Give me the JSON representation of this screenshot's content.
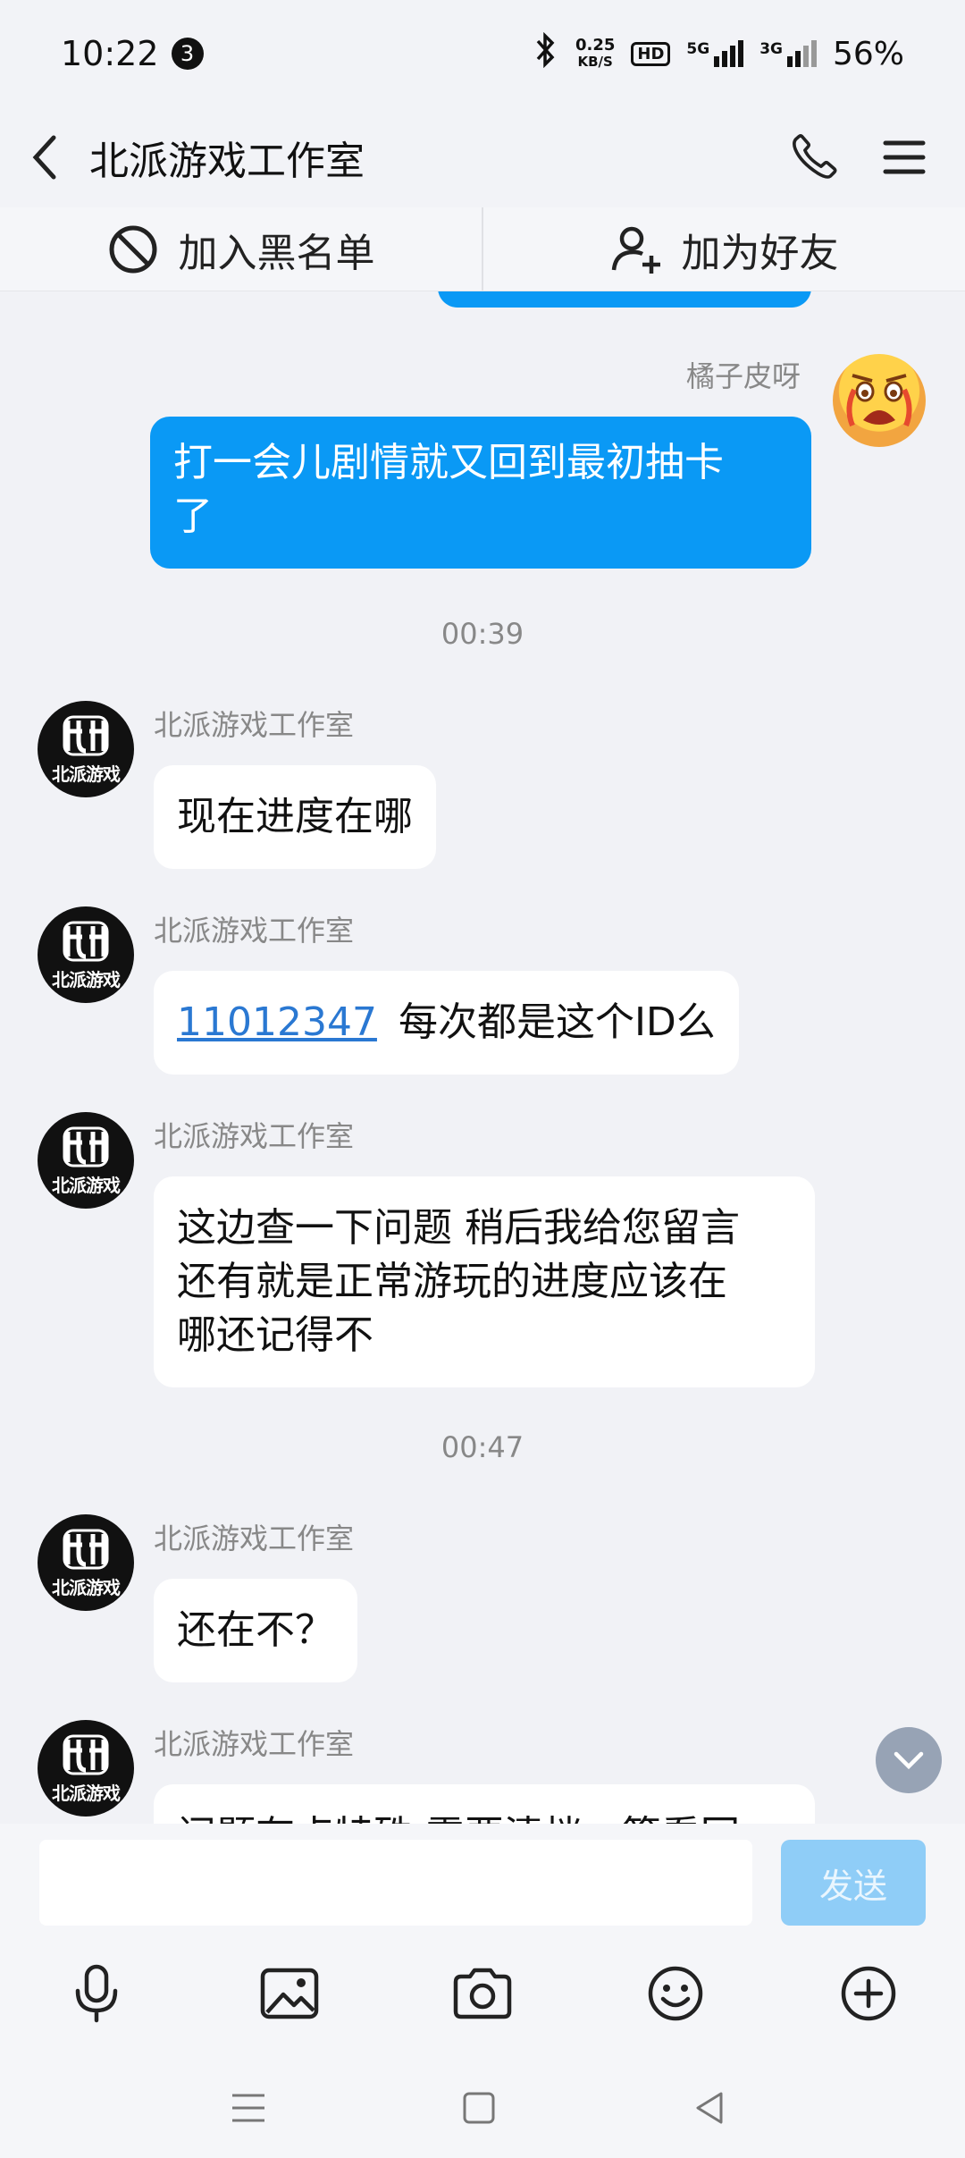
{
  "status_bar": {
    "time": "10:22",
    "notification_count": "3",
    "net_speed_value": "0.25",
    "net_speed_unit": "KB/S",
    "hd_label": "HD",
    "signal1_label": "5G",
    "signal2_label": "3G",
    "battery": "56%"
  },
  "header": {
    "title": "北派游戏工作室"
  },
  "actions": {
    "blacklist_label": "加入黑名单",
    "add_friend_label": "加为好友"
  },
  "messages": [
    {
      "sender": "橘子皮呀",
      "text_line1": "打一会儿剧情就又回到最初抽卡",
      "text_line2": "了"
    },
    {
      "time": "00:39"
    },
    {
      "sender": "北派游戏工作室",
      "text": "现在进度在哪"
    },
    {
      "sender": "北派游戏工作室",
      "link": "11012347",
      "text": "每次都是这个ID么"
    },
    {
      "sender": "北派游戏工作室",
      "line1": "这边查一下问题   稍后我给您留言",
      "line2": "还有就是正常游玩的进度应该在",
      "line3": "哪还记得不"
    },
    {
      "time": "00:47"
    },
    {
      "sender": "北派游戏工作室",
      "text": "还在不？"
    },
    {
      "sender": "北派游戏工作室",
      "text": "问题有点特殊  需要清档一算看回"
    }
  ],
  "avatar_brand": "北派游戏",
  "input": {
    "placeholder": "",
    "send_label": "发送"
  },
  "colors": {
    "outgoing_bubble": "#0a99f5",
    "link": "#2a78d2",
    "send_disabled": "#8fcdf7"
  }
}
